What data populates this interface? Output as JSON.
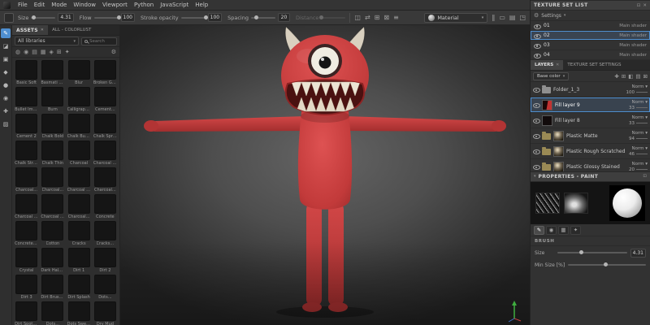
{
  "colors": {
    "accent": "#4f8fd0",
    "monster_red": "#c63a3a",
    "panel_bg": "#323232",
    "viewport_center": "#646464"
  },
  "menubar": {
    "items": [
      "File",
      "Edit",
      "Mode",
      "Window",
      "Viewport",
      "Python",
      "JavaScript",
      "Help"
    ]
  },
  "toolbar": {
    "sliders": [
      {
        "label": "Size",
        "value": "4.31",
        "pos": 10,
        "disabled": false
      },
      {
        "label": "Flow",
        "value": "100",
        "pos": 100,
        "disabled": false
      },
      {
        "label": "Stroke opacity",
        "value": "100",
        "pos": 100,
        "disabled": false
      },
      {
        "label": "Spacing",
        "value": "20",
        "pos": 20,
        "disabled": false
      },
      {
        "label": "Distance",
        "value": "",
        "pos": 0,
        "disabled": true
      }
    ],
    "icons": [
      {
        "name": "symmetry-icon",
        "glyph": "◫"
      },
      {
        "name": "lazy-mouse-icon",
        "glyph": "⇄"
      },
      {
        "name": "grid-snap-icon",
        "glyph": "⊞"
      },
      {
        "name": "stencil-icon",
        "glyph": "⊠"
      },
      {
        "name": "align-icon",
        "glyph": "≡"
      }
    ],
    "material_label": "Material",
    "right_icons": [
      {
        "name": "pause-engine-icon",
        "glyph": "‖"
      },
      {
        "name": "display-settings-icon",
        "glyph": "▭"
      },
      {
        "name": "shader-settings-icon",
        "glyph": "▤"
      },
      {
        "name": "camera-settings-icon",
        "glyph": "◳"
      }
    ]
  },
  "tools": {
    "items": [
      {
        "name": "paint-brush-tool",
        "glyph": "✎"
      },
      {
        "name": "eraser-tool",
        "glyph": "◪"
      },
      {
        "name": "projection-tool",
        "glyph": "▣"
      },
      {
        "name": "polygon-fill-tool",
        "glyph": "◆"
      },
      {
        "name": "smudge-tool",
        "glyph": "●"
      },
      {
        "name": "clone-tool",
        "glyph": "◉"
      },
      {
        "name": "material-picker-tool",
        "glyph": "✚"
      },
      {
        "name": "quick-mask-tool",
        "glyph": "▨"
      }
    ]
  },
  "assets": {
    "tab": "ASSETS",
    "secondary_tab": "ALL - COLORLUST",
    "library_filter": "All libraries",
    "search_placeholder": "Search",
    "filter_icons": [
      {
        "name": "filter-all-icon",
        "glyph": "◍"
      },
      {
        "name": "filter-brushes-icon",
        "glyph": "◉"
      },
      {
        "name": "filter-materials-icon",
        "glyph": "▤"
      },
      {
        "name": "filter-smart-materials-icon",
        "glyph": "▦"
      },
      {
        "name": "filter-alphas-icon",
        "glyph": "◈"
      },
      {
        "name": "filter-textures-icon",
        "glyph": "⊞"
      },
      {
        "name": "filter-effects-icon",
        "glyph": "✦"
      }
    ],
    "brushes": [
      "Basic Soft",
      "Basmati B...",
      "Blur",
      "Broken Glass",
      "Bullet Imp...",
      "Burn",
      "Calligraphic",
      "Cement...",
      "Cement 2",
      "Chalk Bold",
      "Chalk Bum...",
      "Chalk Spre...",
      "Chalk Strong",
      "Chalk Thin",
      "Charcoal",
      "Charcoal B...",
      "Charcoal...",
      "Charcoal...",
      "Charcoal L...",
      "Charcoal...",
      "Charcoal F...",
      "Charcoal S...",
      "Charcoal...",
      "Concrete",
      "Concrete L...",
      "Cotton",
      "Cracks",
      "Cracks...",
      "Crystal",
      "Dark Halo...",
      "Dirt 1",
      "Dirt 2",
      "Dirt 3",
      "Dirt Brushed",
      "Dirt Splash",
      "Dots...",
      "Dirt Spots...",
      "Dots...",
      "Dots Sweed",
      "Dry Mud"
    ]
  },
  "texture_set_list": {
    "title": "TEXTURE SET LIST",
    "settings_label": "Settings",
    "sets": [
      {
        "name": "01",
        "shader": "Main shader",
        "selected": false
      },
      {
        "name": "02",
        "shader": "Main shader",
        "selected": true
      },
      {
        "name": "03",
        "shader": "Main shader",
        "selected": false
      },
      {
        "name": "04",
        "shader": "Main shader",
        "selected": false
      }
    ]
  },
  "layers_panel": {
    "tabs": [
      "LAYERS",
      "TEXTURE SET SETTINGS"
    ],
    "channel": "Base color",
    "action_icons": [
      {
        "name": "add-effect-icon",
        "glyph": "✚"
      },
      {
        "name": "add-layer-icon",
        "glyph": "⊞"
      },
      {
        "name": "add-fill-layer-icon",
        "glyph": "◧"
      },
      {
        "name": "add-folder-icon",
        "glyph": "▤"
      },
      {
        "name": "delete-layer-icon",
        "glyph": "⊠"
      }
    ],
    "layers": [
      {
        "name": "Folder_1_3",
        "blend": "Norm",
        "opacity": "100",
        "type": "folder",
        "selected": false
      },
      {
        "name": "Fill layer 9",
        "blend": "Norm",
        "opacity": "33",
        "type": "fill-red",
        "selected": true
      },
      {
        "name": "Fill layer 8",
        "blend": "Norm",
        "opacity": "33",
        "type": "fill-dark",
        "selected": false
      },
      {
        "name": "Plastic Matte",
        "blend": "Norm",
        "opacity": "94",
        "type": "smart",
        "selected": false
      },
      {
        "name": "Plastic Rough Scratched",
        "blend": "Norm",
        "opacity": "46",
        "type": "smart",
        "selected": false
      },
      {
        "name": "Plastic Glossy Stained",
        "blend": "Norm",
        "opacity": "20",
        "type": "smart",
        "selected": false
      }
    ]
  },
  "properties": {
    "title": "PROPERTIES - PAINT",
    "tool_tabs": [
      {
        "name": "brush-tab-icon",
        "glyph": "✎",
        "active": true
      },
      {
        "name": "alpha-tab-icon",
        "glyph": "◉",
        "active": false
      },
      {
        "name": "stencil-tab-icon",
        "glyph": "▦",
        "active": false
      },
      {
        "name": "material-tab-icon",
        "glyph": "✦",
        "active": false
      }
    ],
    "brush_section": "BRUSH",
    "sliders": [
      {
        "label": "Size",
        "value": "4.31",
        "pos": 34
      },
      {
        "label": "Min Size [%]",
        "value": "",
        "pos": 48
      }
    ]
  }
}
